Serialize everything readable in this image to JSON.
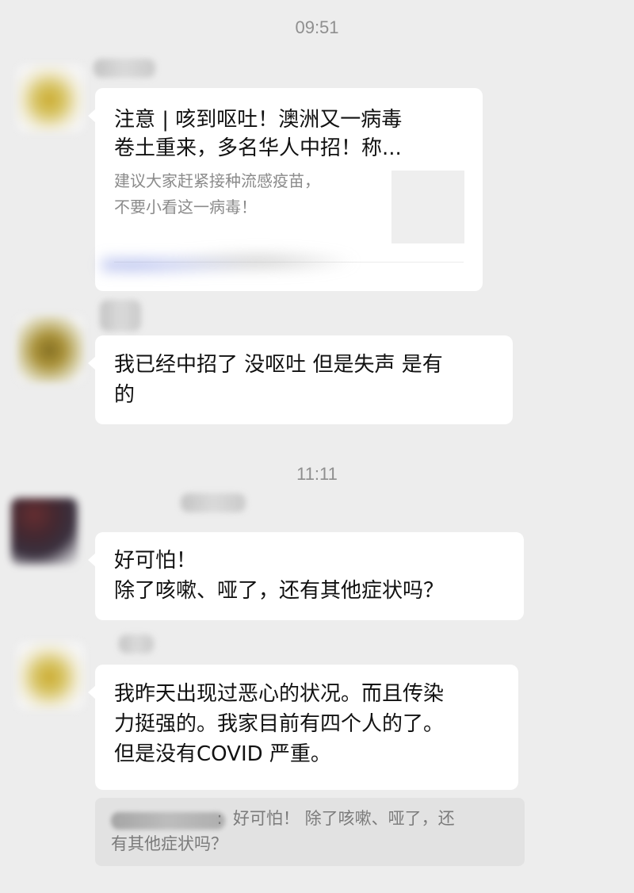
{
  "timestamps": [
    "09:51",
    "11:11"
  ],
  "messages": [
    {
      "type": "link-card",
      "title": "注意 | 咳到呕吐！澳洲又一病毒\n卷土重来，多名华人中招！称...",
      "description": "建议大家赶紧接种流感疫苗，\n不要小看这一病毒！"
    },
    {
      "type": "text",
      "text": "我已经中招了 没呕吐 但是失声 是有\n的"
    },
    {
      "type": "text",
      "text": "好可怕！\n除了咳嗽、哑了，还有其他症状吗？"
    },
    {
      "type": "text",
      "text": "我昨天出现过恶心的状况。而且传染\n力挺强的。我家目前有四个人的了。\n但是没有COVID 严重。"
    }
  ],
  "quote": {
    "text": "                    :  好可怕！ 除了咳嗽、哑了，还\n有其他症状吗？"
  },
  "colors": {
    "background": "#ededed",
    "bubble": "#ffffff",
    "quote_background": "#e2e2e2",
    "timestamp": "#8f8f8f",
    "card_description": "#8b8b8b"
  }
}
